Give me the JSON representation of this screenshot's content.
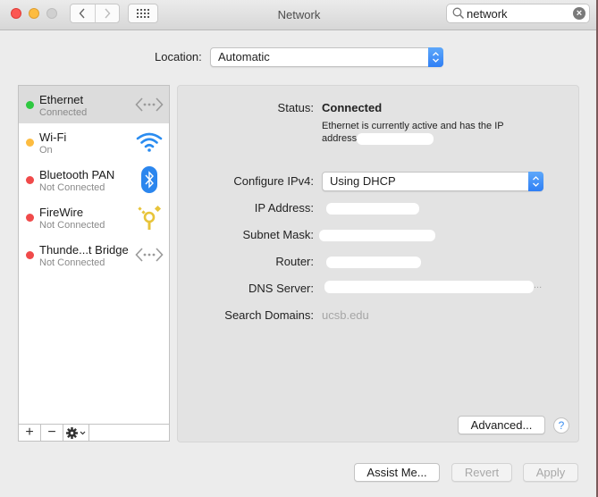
{
  "window": {
    "title": "Network",
    "search": {
      "value": "network",
      "placeholder": "Search"
    }
  },
  "location": {
    "label": "Location:",
    "value": "Automatic"
  },
  "services": [
    {
      "name": "Ethernet",
      "status": "Connected",
      "status_color": "#2ec840",
      "icon": "ethernet-icon",
      "selected": true
    },
    {
      "name": "Wi-Fi",
      "status": "On",
      "status_color": "#fdbc40",
      "icon": "wifi-icon",
      "selected": false
    },
    {
      "name": "Bluetooth PAN",
      "status": "Not Connected",
      "status_color": "#f04a4a",
      "icon": "bluetooth-icon",
      "selected": false
    },
    {
      "name": "FireWire",
      "status": "Not Connected",
      "status_color": "#f04a4a",
      "icon": "firewire-icon",
      "selected": false
    },
    {
      "name": "Thunde...t Bridge",
      "status": "Not Connected",
      "status_color": "#f04a4a",
      "icon": "thunderbolt-bridge-icon",
      "selected": false
    }
  ],
  "sidebar_toolbar": {
    "add": "+",
    "remove": "−"
  },
  "detail": {
    "status_label": "Status:",
    "status_value": "Connected",
    "status_desc": "Ethernet is currently active and has the IP address",
    "configure_label": "Configure IPv4:",
    "configure_value": "Using DHCP",
    "ip_label": "IP Address:",
    "subnet_label": "Subnet Mask:",
    "router_label": "Router:",
    "dns_label": "DNS Server:",
    "dns_ellipsis": "...",
    "search_domains_label": "Search Domains:",
    "search_domains_value": "ucsb.edu"
  },
  "buttons": {
    "advanced": "Advanced...",
    "help": "?",
    "assist": "Assist Me...",
    "revert": "Revert",
    "apply": "Apply"
  }
}
